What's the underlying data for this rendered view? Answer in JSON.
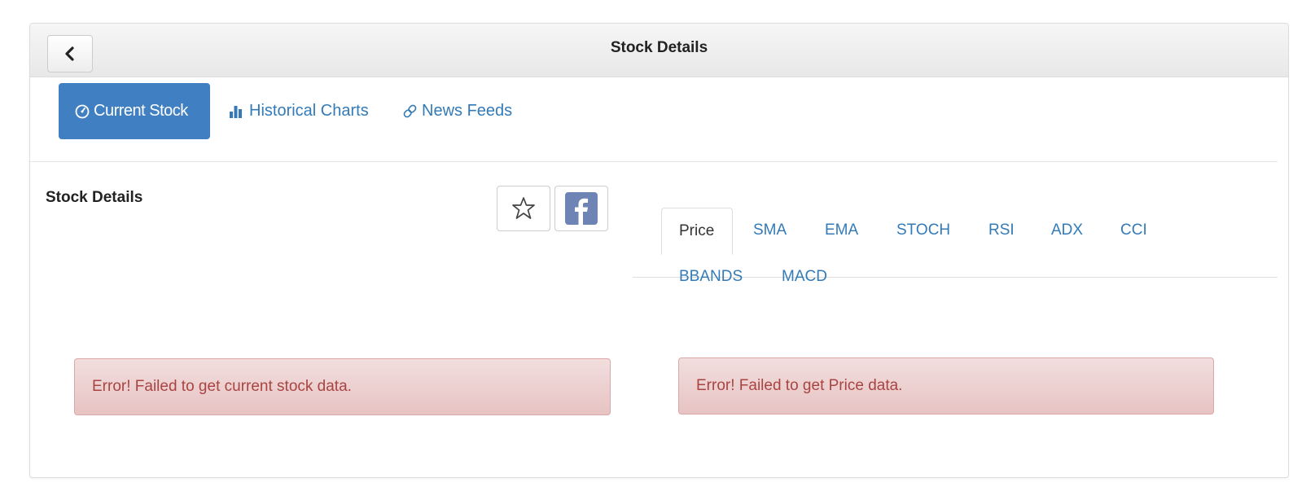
{
  "header": {
    "title": "Stock Details"
  },
  "nav": {
    "items": [
      {
        "label": "Current Stock",
        "icon": "dashboard-icon",
        "active": true
      },
      {
        "label": "Historical Charts",
        "icon": "bar-chart-icon",
        "active": false
      },
      {
        "label": "News Feeds",
        "icon": "link-icon",
        "active": false
      }
    ]
  },
  "details": {
    "title": "Stock Details",
    "favorite_icon": "star-icon",
    "share_icon": "facebook-icon"
  },
  "indicator_tabs": [
    {
      "label": "Price",
      "active": true
    },
    {
      "label": "SMA"
    },
    {
      "label": "EMA"
    },
    {
      "label": "STOCH"
    },
    {
      "label": "RSI"
    },
    {
      "label": "ADX"
    },
    {
      "label": "CCI"
    },
    {
      "label": "BBANDS"
    },
    {
      "label": "MACD"
    }
  ],
  "alerts": {
    "stock_error": "Error! Failed to get current stock data.",
    "price_error": "Error! Failed to get Price data."
  },
  "colors": {
    "accent": "#3f7fc2",
    "link": "#337ab7",
    "error_text": "#a94442",
    "error_bg": "#f2dede",
    "facebook": "#6d84b4"
  }
}
